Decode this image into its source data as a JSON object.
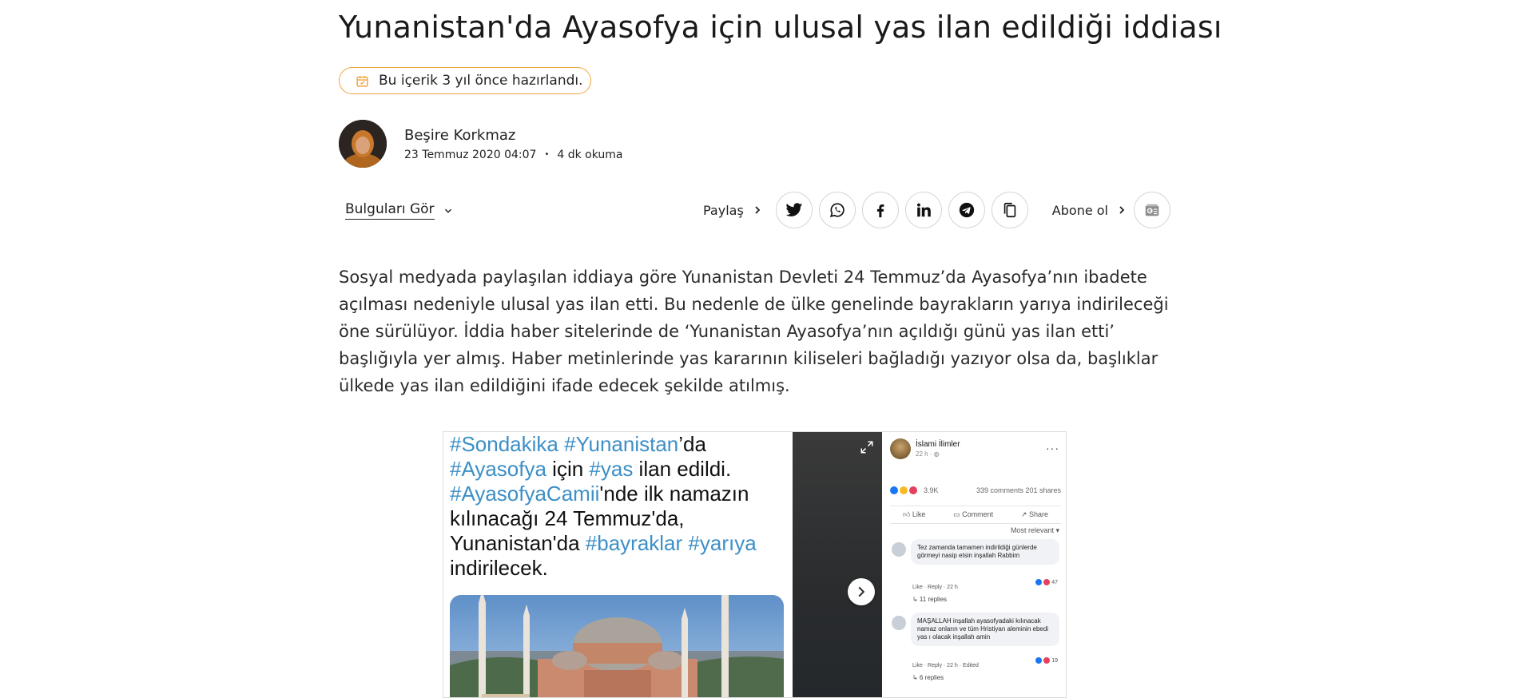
{
  "article": {
    "title": "Yunanistan'da Ayasofya için ulusal yas ilan edildiği iddiası",
    "age_notice": "Bu içerik 3 yıl önce hazırlandı.",
    "author": {
      "name": "Beşire Korkmaz",
      "date": "23 Temmuz 2020 04:07",
      "read_time": "4 dk okuma",
      "separator": "•"
    },
    "findings_label": "Bulguları Gör",
    "share_label": "Paylaş",
    "share_buttons": [
      "twitter-icon",
      "whatsapp-icon",
      "facebook-icon",
      "linkedin-icon",
      "telegram-icon",
      "copy-icon"
    ],
    "subscribe_label": "Abone ol",
    "body": "Sosyal medyada paylaşılan iddiaya göre Yunanistan Devleti 24 Temmuz’da Ayasofya’nın ibadete açılması nedeniyle ulusal yas ilan etti. Bu nedenle de ülke genelinde bayrakların yarıya indirileceği öne sürülüyor. İddia haber sitelerinde de ‘Yunanistan Ayasofya’nın açıldığı günü yas ilan etti’ başlığıyla yer almış. Haber metinlerinde yas kararının kiliseleri bağladığı yazıyor olsa da, başlıklar ülkede yas ilan edildiğini ifade edecek şekilde atılmış."
  },
  "evidence_image": {
    "tweet": {
      "t1": "#Sondakika",
      "t2": "#Yunanistan",
      "t3": "’da",
      "t4": "#Ayasofya",
      "t5": " için ",
      "t6": "#yas",
      "t7": " ilan edildi.",
      "t8": "#AyasofyaCamii",
      "t9": "'nde ilk namazın",
      "t10": "kılınacağı 24 Temmuz'da,",
      "t11": "Yunanistan'da ",
      "t12": "#bayraklar",
      "t13": " ",
      "t14": "#yarıya",
      "t15": "indirilecek."
    },
    "facebook": {
      "page_name": "İslami İlimler",
      "time": "22 h · ",
      "reactions_count": "3.9K",
      "comments_shares": "339 comments  201 shares",
      "like": "Like",
      "comment": "Comment",
      "share": "Share",
      "sort": "Most relevant",
      "comments": [
        {
          "text": "Tez zamanda tamamen indirildiği günlerde görmeyi nasip etsin inşallah Rabbim",
          "meta": "Like · Reply · 22 h",
          "replies": "↳ 11 replies",
          "react_count": "47"
        },
        {
          "text": "MAŞALLAH inşallah ayasofyadaki kılınacak namaz onların ve tüm Hristiyan aleminin ebedi yas ı olacak inşallah amin",
          "meta": "Like · Reply · 22 h · Edited",
          "replies": "↳ 6 replies",
          "react_count": "19"
        }
      ]
    }
  },
  "colors": {
    "accent_orange": "#f0a43a",
    "hashtag_blue": "#3d8fc6"
  }
}
